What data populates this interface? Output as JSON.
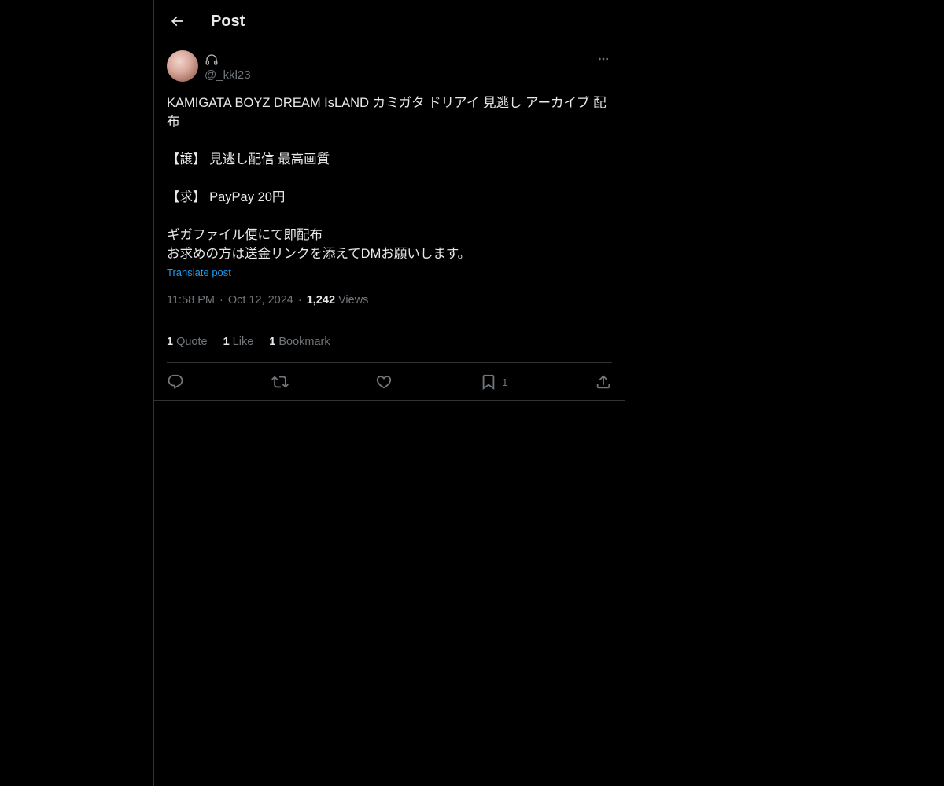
{
  "header": {
    "title": "Post",
    "back_icon": "arrow-left-icon"
  },
  "author": {
    "display_name_icon": "headphones-icon",
    "handle": "@_kkl23",
    "more_icon": "more-horizontal-icon"
  },
  "post": {
    "lines": [
      "KAMIGATA BOYZ DREAM IsLAND カミガタ ドリアイ 見逃し アーカイブ 配布",
      "",
      "【譲】 見逃し配信 最高画質",
      "",
      "【求】 PayPay 20円",
      "",
      "ギガファイル便にて即配布",
      "お求めの方は送金リンクを添えてDMお願いします。"
    ],
    "translate_label": "Translate post"
  },
  "meta": {
    "time": "11:58 PM",
    "separator": "·",
    "date": "Oct 12, 2024",
    "views_count": "1,242",
    "views_label": "Views"
  },
  "stats": {
    "quotes_count": "1",
    "quotes_label": "Quote",
    "likes_count": "1",
    "likes_label": "Like",
    "bookmarks_count": "1",
    "bookmarks_label": "Bookmark"
  },
  "actions": {
    "reply_icon": "reply-icon",
    "repost_icon": "repost-icon",
    "like_icon": "heart-icon",
    "bookmark_icon": "bookmark-icon",
    "bookmark_count": "1",
    "share_icon": "share-icon"
  },
  "colors": {
    "background": "#000000",
    "text_primary": "#e7e9ea",
    "text_secondary": "#71767b",
    "link": "#1d9bf0",
    "border": "#2f3336"
  }
}
